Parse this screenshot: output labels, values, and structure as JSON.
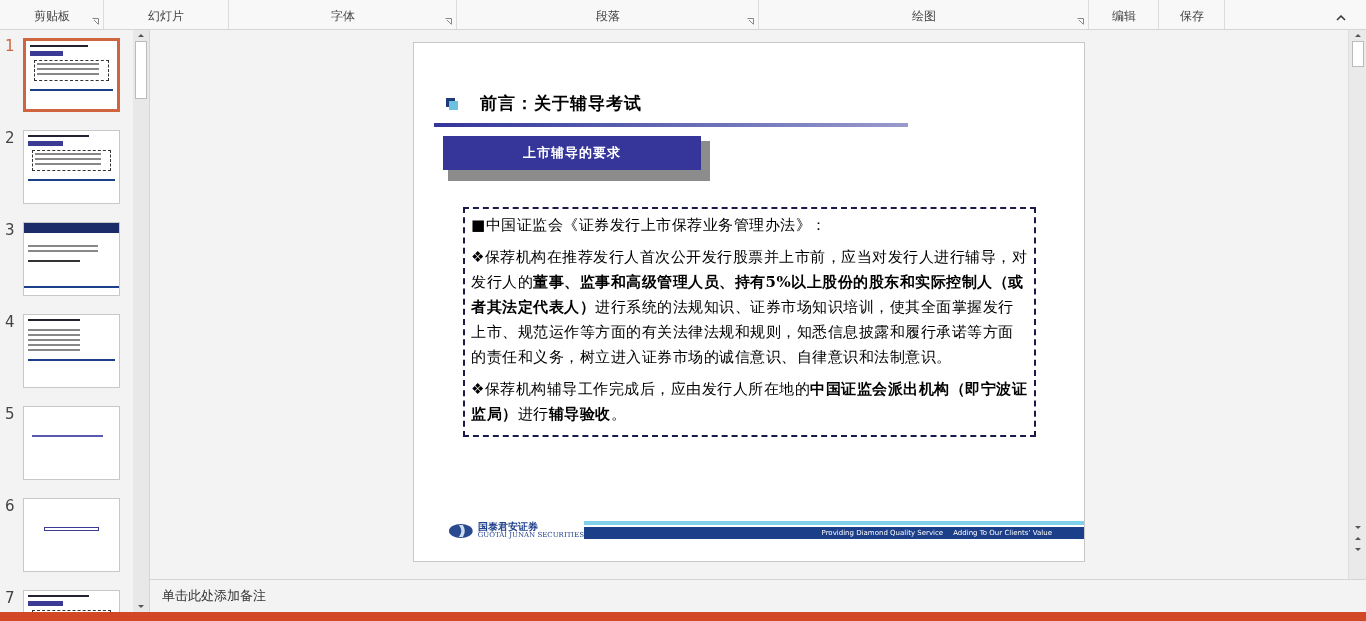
{
  "ribbon": {
    "groups": [
      {
        "label": "剪贴板",
        "launcher": true
      },
      {
        "label": "幻灯片",
        "launcher": false
      },
      {
        "label": "字体",
        "launcher": true
      },
      {
        "label": "段落",
        "launcher": true
      },
      {
        "label": "绘图",
        "launcher": true
      },
      {
        "label": "编辑",
        "launcher": false
      },
      {
        "label": "保存",
        "launcher": false
      }
    ]
  },
  "thumbnails": [
    {
      "number": "1",
      "selected": true,
      "kind": "text"
    },
    {
      "number": "2",
      "selected": false,
      "kind": "text"
    },
    {
      "number": "3",
      "selected": false,
      "kind": "cover"
    },
    {
      "number": "4",
      "selected": false,
      "kind": "outline"
    },
    {
      "number": "5",
      "selected": false,
      "kind": "line"
    },
    {
      "number": "6",
      "selected": false,
      "kind": "box"
    },
    {
      "number": "7",
      "selected": false,
      "kind": "text"
    }
  ],
  "slide": {
    "title": "前言：关于辅导考试",
    "section_label": "上市辅导的要求",
    "paragraphs": [
      "■中国证监会《证券发行上市保荐业务管理办法》：",
      "❖保荐机构在推荐发行人首次公开发行股票并上市前，应当对发行人进行辅导，对发行人的**董事、监事和高级管理人员、持有5%以上股份的股东和实际控制人（或者其法定代表人）**进行系统的法规知识、证券市场知识培训，使其全面掌握发行上市、规范运作等方面的有关法律法规和规则，知悉信息披露和履行承诺等方面的责任和义务，树立进入证券市场的诚信意识、自律意识和法制意识。",
      "❖保荐机构辅导工作完成后，应由发行人所在地的**中国证监会派出机构（即宁波证监局）**进行**辅导验收**。"
    ],
    "footer": {
      "company_name": "国泰君安证券",
      "company_name_en": "GUOTAI JUNAN SECURITIES",
      "slogan_1": "Providing Diamond Quality Service",
      "slogan_2": "Adding To Our Clients’ Value"
    }
  },
  "notes": {
    "placeholder": "单击此处添加备注"
  }
}
